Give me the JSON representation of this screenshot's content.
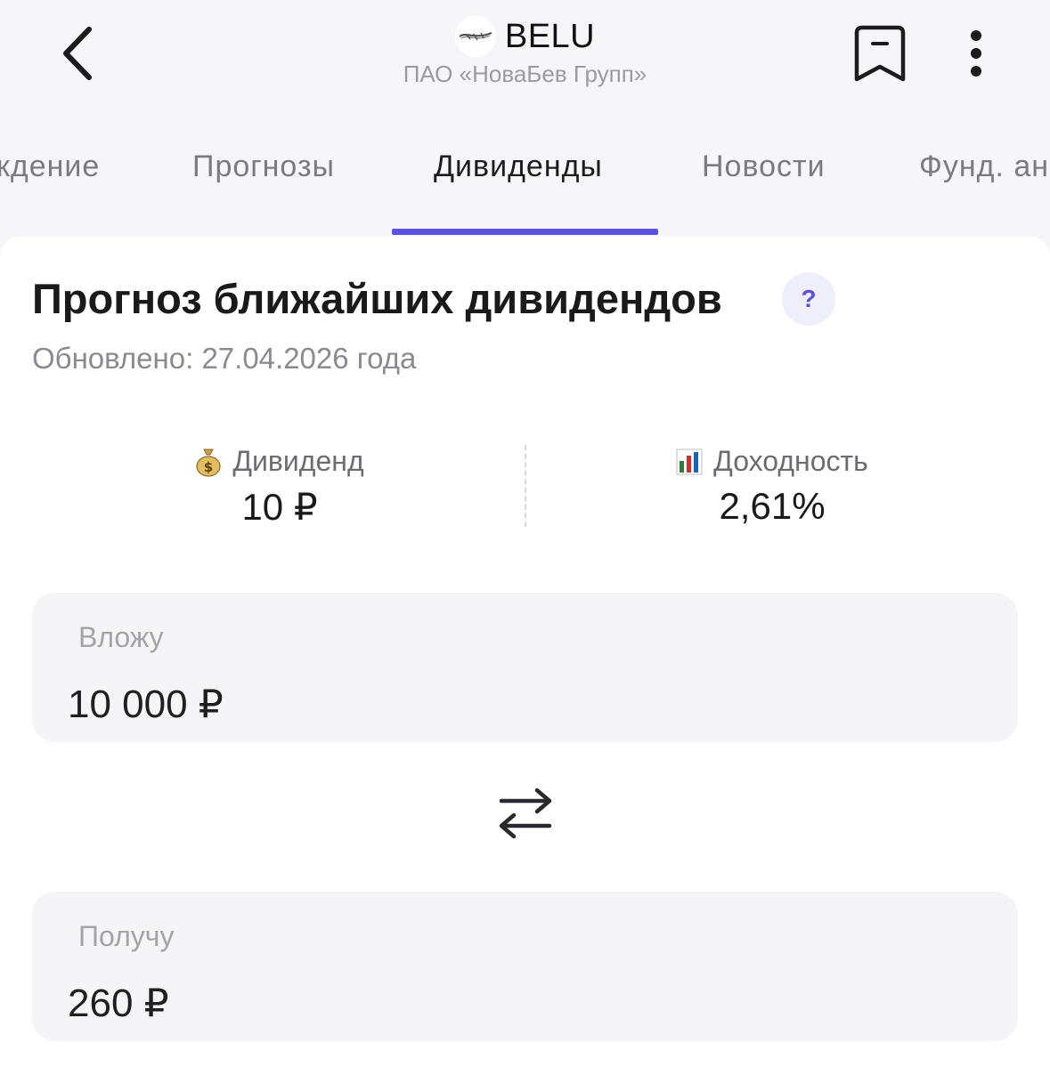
{
  "header": {
    "ticker": "BELU",
    "company": "ПАО «НоваБев Групп»"
  },
  "tabs": [
    {
      "label": "кдение"
    },
    {
      "label": "Прогнозы"
    },
    {
      "label": "Дивиденды",
      "active": true
    },
    {
      "label": "Новости"
    },
    {
      "label": "Фунд. ан"
    }
  ],
  "card": {
    "title": "Прогноз ближайших дивидендов",
    "help": "?",
    "updated": "Обновлено: 27.04.2026 года"
  },
  "stats": {
    "dividend": {
      "icon": "money-bag-icon",
      "label": "Дивиденд",
      "value": "10 ₽"
    },
    "yield": {
      "icon": "bar-chart-icon",
      "label": "Доходность",
      "value": "2,61%"
    }
  },
  "invest": {
    "label": "Вложу",
    "value": "10 000 ₽"
  },
  "receive": {
    "label": "Получу",
    "value": "260 ₽"
  },
  "colors": {
    "accent": "#5d51e3",
    "background": "#f6f6fa",
    "card": "#ffffff",
    "field": "#f5f5f7"
  }
}
